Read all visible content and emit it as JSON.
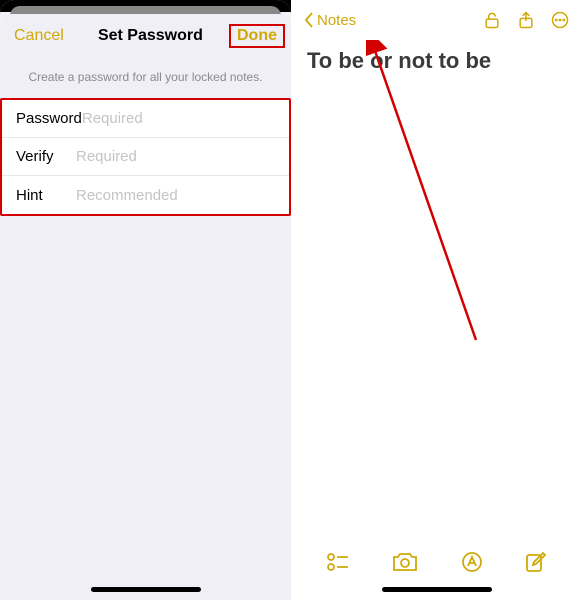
{
  "left": {
    "nav": {
      "cancel": "Cancel",
      "title": "Set Password",
      "done": "Done"
    },
    "subtitle": "Create a password for all your locked notes.",
    "fields": {
      "password": {
        "label": "Password",
        "placeholder": "Required",
        "value": ""
      },
      "verify": {
        "label": "Verify",
        "placeholder": "Required",
        "value": ""
      },
      "hint": {
        "label": "Hint",
        "placeholder": "Recommended",
        "value": ""
      }
    }
  },
  "right": {
    "back_label": "Notes",
    "note_title": "To be or not to be",
    "icons": {
      "lock": "unlock-icon",
      "share": "share-icon",
      "more": "more-icon",
      "checklist": "checklist-icon",
      "camera": "camera-icon",
      "draw": "draw-icon",
      "compose": "compose-icon"
    }
  },
  "colors": {
    "accent": "#d0a908",
    "highlight": "#d40000"
  }
}
